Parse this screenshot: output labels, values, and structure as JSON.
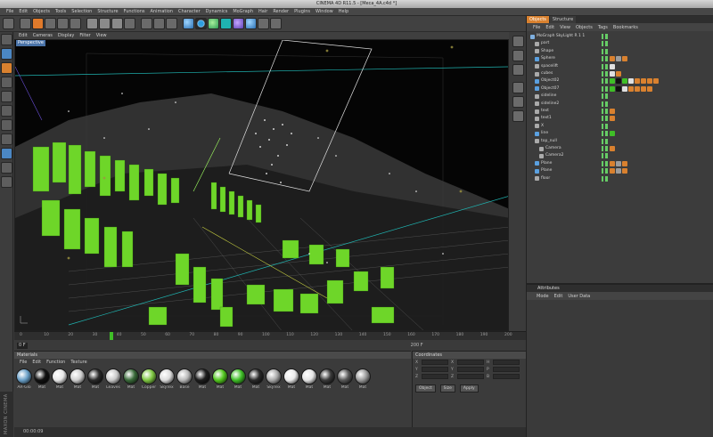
{
  "window": {
    "title": "CINEMA 4D R11.5 - [Meca_4A.c4d *]"
  },
  "menu": [
    "File",
    "Edit",
    "Objects",
    "Tools",
    "Selection",
    "Structure",
    "Functions",
    "Animation",
    "Character",
    "Dynamics",
    "MoGraph",
    "Hair",
    "Render",
    "Plugins",
    "Window",
    "Help"
  ],
  "viewport": {
    "menu": [
      "Edit",
      "Cameras",
      "Display",
      "Filter",
      "View"
    ],
    "label": "Perspective"
  },
  "timeline": {
    "ticks": [
      "0",
      "5",
      "10",
      "15",
      "20",
      "25",
      "30",
      "35",
      "40",
      "45",
      "50",
      "55",
      "60",
      "65",
      "70",
      "75",
      "80",
      "85",
      "90",
      "95",
      "100",
      "105",
      "110",
      "115",
      "120",
      "125",
      "130",
      "135",
      "140",
      "145",
      "150",
      "155",
      "160",
      "165",
      "170",
      "175",
      "180",
      "185",
      "190",
      "195",
      "200"
    ],
    "current_frame": "0 F",
    "end_frame": "200 F"
  },
  "materials": {
    "title": "Materials",
    "menu": [
      "File",
      "Edit",
      "Function",
      "Texture"
    ],
    "items": [
      {
        "label": "AR-Glo",
        "color": "#6aa0c8"
      },
      {
        "label": "Mat",
        "color": "#111111"
      },
      {
        "label": "Mat",
        "color": "#e8e8e8"
      },
      {
        "label": "Mat",
        "color": "#d0d0d0"
      },
      {
        "label": "Mat",
        "color": "#2a2a2a"
      },
      {
        "label": "Leaves",
        "color": "#c9c9c9"
      },
      {
        "label": "Mat",
        "color": "#3a6a3a"
      },
      {
        "label": "Copper",
        "color": "#7fc843"
      },
      {
        "label": "SkyTex",
        "color": "#dcdcdc"
      },
      {
        "label": "Base",
        "color": "#b9b9b9"
      },
      {
        "label": "Mat",
        "color": "#1e1e1e"
      },
      {
        "label": "Mat",
        "color": "#53c81f"
      },
      {
        "label": "Mat",
        "color": "#3fbf27"
      },
      {
        "label": "Mat",
        "color": "#2a2a2a"
      },
      {
        "label": "SkyTex",
        "color": "#a9a9a9"
      },
      {
        "label": "Mat",
        "color": "#eaeaea"
      },
      {
        "label": "Mat",
        "color": "#e6e6e6"
      },
      {
        "label": "Mat",
        "color": "#3a3a3a"
      },
      {
        "label": "Mat",
        "color": "#585858"
      },
      {
        "label": "Mat",
        "color": "#9a9a9a"
      }
    ]
  },
  "coordinates": {
    "title": "Coordinates",
    "rows": [
      {
        "a": "X",
        "b": "X",
        "c": "H"
      },
      {
        "a": "Y",
        "b": "Y",
        "c": "P"
      },
      {
        "a": "Z",
        "b": "Z",
        "c": "B"
      }
    ],
    "buttons": [
      "Object",
      "Size",
      "Apply"
    ]
  },
  "status": {
    "text": "00:00:09"
  },
  "logo": "MAXON CINEMA 4D",
  "objects": {
    "tabs": [
      "Objects",
      "Structure"
    ],
    "menu": [
      "File",
      "Edit",
      "View",
      "Objects",
      "Tags",
      "Bookmarks"
    ],
    "rows": [
      {
        "name": "MoGraph SkyLight R 1 1",
        "indent": 0,
        "icon": "#7fb0e0",
        "tags": []
      },
      {
        "name": "part",
        "indent": 1,
        "icon": "#aaaaaa",
        "tags": []
      },
      {
        "name": "Shape",
        "indent": 1,
        "icon": "#aaaaaa",
        "tags": []
      },
      {
        "name": "Sphere",
        "indent": 1,
        "icon": "#5aa0e0",
        "tags": [
          "#d9812f",
          "#9c9c9c",
          "#d9812f"
        ]
      },
      {
        "name": "spacelift",
        "indent": 1,
        "icon": "#aaaaaa",
        "tags": [
          "#e0e0e0"
        ]
      },
      {
        "name": "cubes",
        "indent": 1,
        "icon": "#aaaaaa",
        "tags": [
          "#e0e0e0",
          "#d9812f"
        ]
      },
      {
        "name": "Object02",
        "indent": 1,
        "icon": "#5aa0e0",
        "tags": [
          "#3fbf27",
          "#111111",
          "#3fbf27",
          "#e0e0e0",
          "#d9812f",
          "#d9812f",
          "#d9812f",
          "#d9812f"
        ]
      },
      {
        "name": "Object07",
        "indent": 1,
        "icon": "#5aa0e0",
        "tags": [
          "#3fbf27",
          "#111111",
          "#e0e0e0",
          "#d9812f",
          "#d9812f",
          "#d9812f",
          "#d9812f"
        ]
      },
      {
        "name": "sideline",
        "indent": 1,
        "icon": "#aaaaaa",
        "tags": []
      },
      {
        "name": "sideline2",
        "indent": 1,
        "icon": "#aaaaaa",
        "tags": []
      },
      {
        "name": "text",
        "indent": 1,
        "icon": "#aaaaaa",
        "tags": [
          "#d9812f"
        ]
      },
      {
        "name": "text1",
        "indent": 1,
        "icon": "#aaaaaa",
        "tags": [
          "#d9812f"
        ]
      },
      {
        "name": "X",
        "indent": 1,
        "icon": "#aaaaaa",
        "tags": []
      },
      {
        "name": "line",
        "indent": 1,
        "icon": "#5aa0e0",
        "tags": [
          "#3fbf27"
        ]
      },
      {
        "name": "top_null",
        "indent": 1,
        "icon": "#aaaaaa",
        "tags": []
      },
      {
        "name": "Camera",
        "indent": 2,
        "icon": "#aaaaaa",
        "tags": [
          "#d9812f"
        ]
      },
      {
        "name": "Camera2",
        "indent": 2,
        "icon": "#aaaaaa",
        "tags": []
      },
      {
        "name": "Plane",
        "indent": 1,
        "icon": "#5aa0e0",
        "tags": [
          "#d9812f",
          "#9c9c9c",
          "#d9812f"
        ]
      },
      {
        "name": "Plane",
        "indent": 1,
        "icon": "#5aa0e0",
        "tags": [
          "#d9812f",
          "#9c9c9c",
          "#d9812f"
        ]
      },
      {
        "name": "floor",
        "indent": 1,
        "icon": "#aaaaaa",
        "tags": []
      }
    ]
  },
  "attributes": {
    "title": "Attributes",
    "menu": [
      "Mode",
      "Edit",
      "User Data"
    ]
  }
}
